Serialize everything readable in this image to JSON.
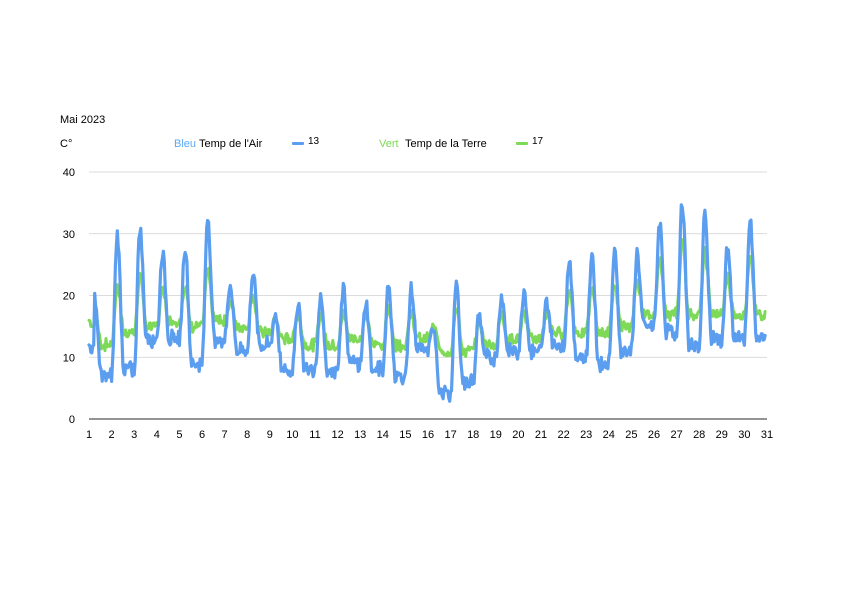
{
  "header": {
    "month_label": "Mai  2023",
    "unit_label": "C°"
  },
  "legend": {
    "air_color_word": "Bleu",
    "air_label": "Temp de l'Air",
    "air_value": "13",
    "ground_color_word": "Vert",
    "ground_label": "Temp de la Terre",
    "ground_value": "17"
  },
  "colors": {
    "air": "#5b9ef0",
    "ground": "#7ed957",
    "air_word": "#5aa9f5",
    "ground_word": "#7ed957",
    "grid": "#cfcfcf",
    "axis": "#555555"
  },
  "chart_data": {
    "type": "line",
    "xlabel": "",
    "ylabel": "C°",
    "ylim": [
      0,
      40
    ],
    "xlim": [
      1,
      31
    ],
    "y_ticks": [
      "0",
      "10",
      "20",
      "30",
      "40"
    ],
    "x_ticks": [
      "1",
      "2",
      "3",
      "4",
      "5",
      "6",
      "7",
      "8",
      "9",
      "10",
      "11",
      "12",
      "13",
      "14",
      "15",
      "16",
      "17",
      "18",
      "19",
      "20",
      "21",
      "22",
      "23",
      "24",
      "25",
      "26",
      "27",
      "28",
      "29",
      "30",
      "31"
    ],
    "grid": "horizontal",
    "daily_air_min": [
      10,
      7,
      8,
      13,
      13,
      9,
      13,
      11,
      12,
      8,
      8,
      8,
      9,
      8,
      7,
      11,
      4,
      6,
      10,
      11,
      11,
      12,
      10,
      9,
      11,
      15,
      14,
      12,
      13,
      13
    ],
    "daily_air_max": [
      12,
      20,
      30,
      31,
      27,
      28,
      33,
      22,
      24,
      17,
      19,
      20,
      21,
      19,
      22,
      21,
      15,
      22,
      17,
      20,
      21,
      19,
      26,
      27,
      27,
      27,
      32,
      35,
      33,
      28,
      32
    ],
    "daily_ground_min": [
      14,
      12,
      14,
      15,
      16,
      15,
      16,
      15,
      14,
      13,
      12,
      12,
      13,
      12,
      12,
      13,
      11,
      11,
      12,
      13,
      13,
      14,
      14,
      14,
      15,
      17,
      17,
      17,
      17,
      17
    ],
    "daily_ground_max": [
      16,
      18,
      22,
      23,
      21,
      21,
      24,
      19,
      20,
      16,
      17,
      17,
      17,
      17,
      18,
      17,
      15,
      18,
      16,
      17,
      17,
      17,
      21,
      21,
      22,
      22,
      26,
      29,
      27,
      23,
      26
    ],
    "series": [
      {
        "name": "Temp de l'Air",
        "color_key": "air"
      },
      {
        "name": "Temp de la Terre",
        "color_key": "ground"
      }
    ]
  }
}
